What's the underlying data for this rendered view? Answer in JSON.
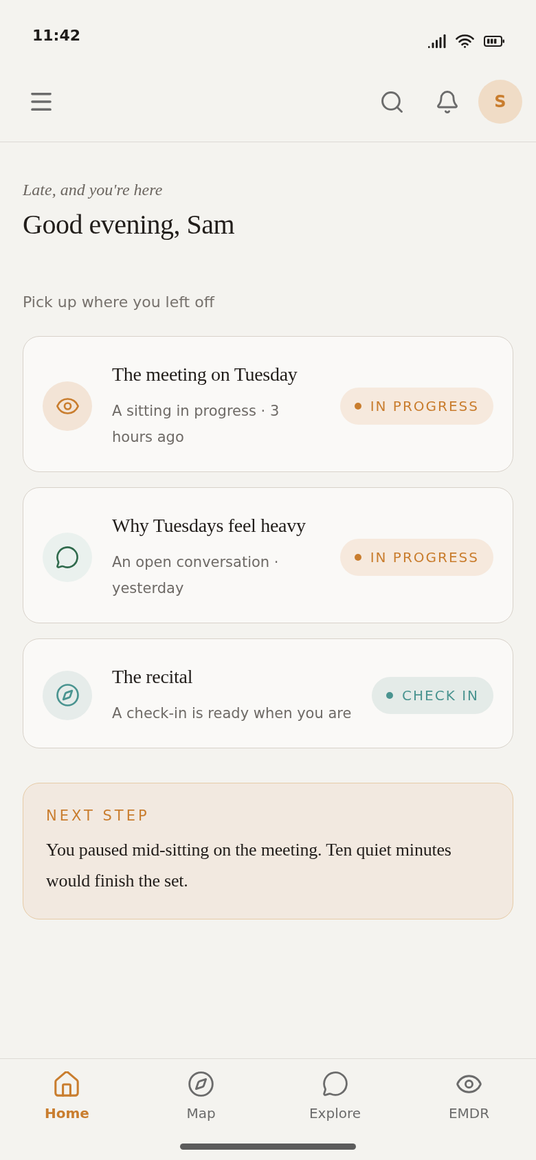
{
  "status_bar": {
    "time": "11:42"
  },
  "header": {
    "avatar_initial": "S"
  },
  "greeting": {
    "kicker": "Late, and you're here",
    "title": "Good evening, Sam"
  },
  "resume": {
    "heading": "Pick up where you left off",
    "items": [
      {
        "kind": "sitting",
        "title": "The meeting on Tuesday",
        "subtitle": "A sitting in progress · 3 hours ago",
        "status": {
          "kind": "in_progress",
          "label": "IN PROGRESS"
        }
      },
      {
        "kind": "conversation",
        "title": "Why Tuesdays feel heavy",
        "subtitle": "An open conversation · yesterday",
        "status": {
          "kind": "in_progress",
          "label": "IN PROGRESS"
        }
      },
      {
        "kind": "checkin",
        "title": "The recital",
        "subtitle": "A check-in is ready when you are",
        "status": {
          "kind": "check_in",
          "label": "CHECK IN"
        }
      }
    ]
  },
  "next_step": {
    "label": "NEXT STEP",
    "text": "You paused mid-sitting on the meeting. Ten quiet minutes would finish the set."
  },
  "nav": [
    {
      "kind": "home",
      "label": "Home",
      "selected": true
    },
    {
      "kind": "compass",
      "label": "Map",
      "selected": false
    },
    {
      "kind": "chat",
      "label": "Explore",
      "selected": false
    },
    {
      "kind": "eye",
      "label": "EMDR",
      "selected": false
    }
  ]
}
